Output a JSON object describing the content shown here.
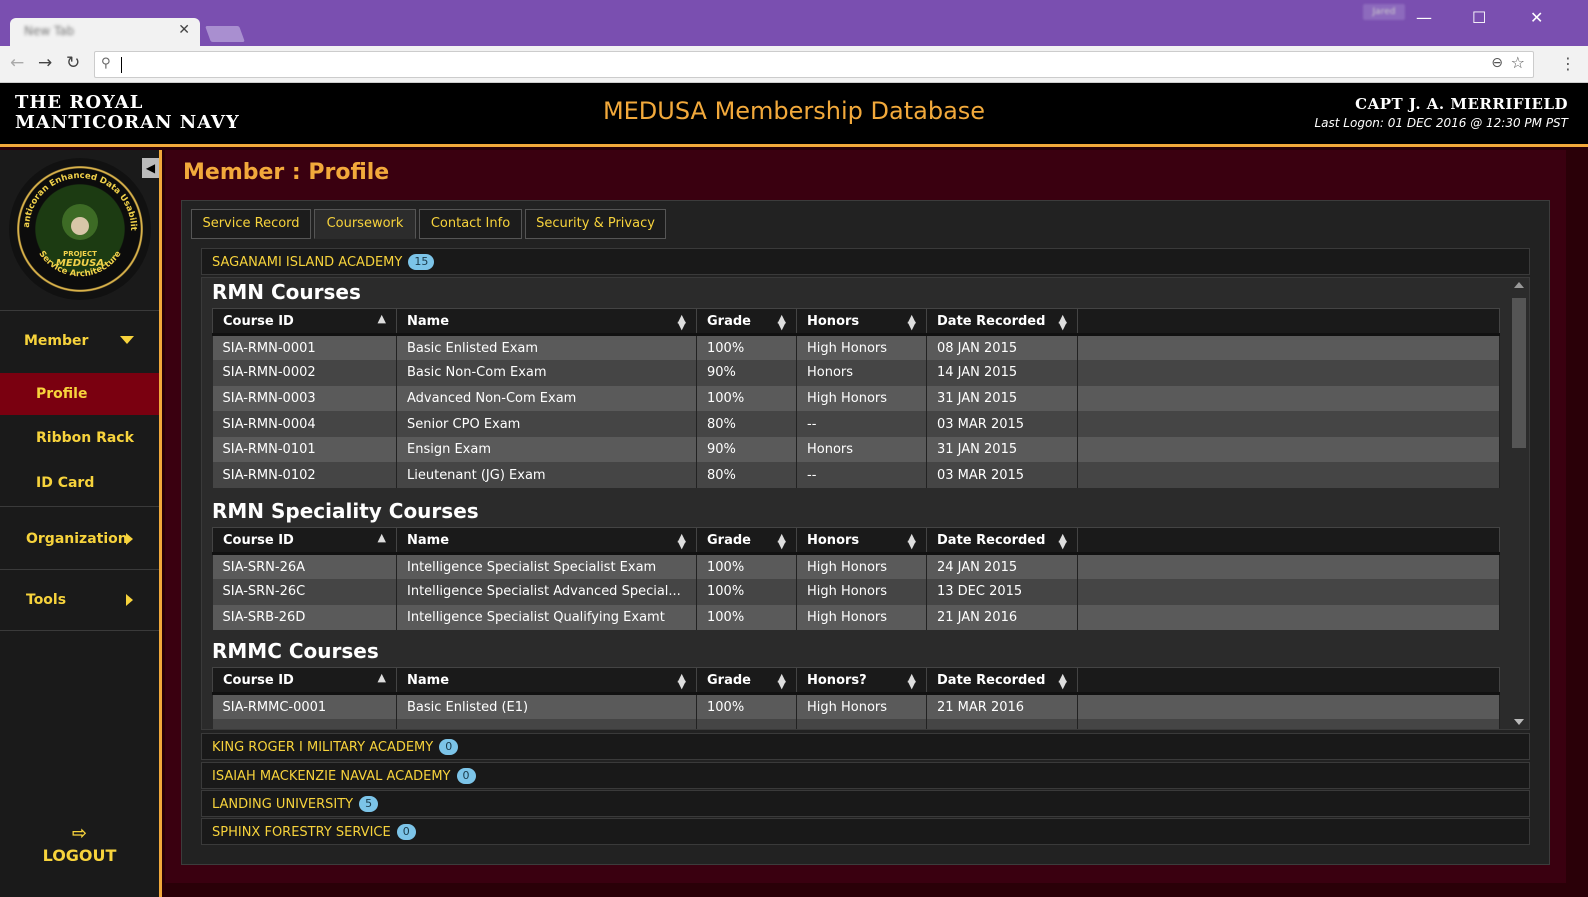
{
  "browser": {
    "tab_title": "New Tab",
    "user_chip": "Jared",
    "address_value": ""
  },
  "header": {
    "brand_line1": "THE ROYAL",
    "brand_line2": "MANTICORAN NAVY",
    "title": "MEDUSA Membership Database",
    "user_name": "CAPT J. A. MERRIFIELD",
    "last_logon": "Last Logon: 01 DEC 2016 @ 12:30 PM PST"
  },
  "logo": {
    "ring_top": "Manticoran Enhanced Data Usability",
    "ring_bottom": "Service Architecture",
    "center_line1": "PROJECT",
    "center_line2": "MEDUSA"
  },
  "sidebar": {
    "member": "Member",
    "profile": "Profile",
    "ribbon_rack": "Ribbon Rack",
    "id_card": "ID Card",
    "organization": "Organization",
    "tools": "Tools",
    "logout": "LOGOUT"
  },
  "page": {
    "title": "Member : Profile",
    "tabs": [
      "Service Record",
      "Coursework",
      "Contact Info",
      "Security & Privacy"
    ]
  },
  "academies": [
    {
      "name": "SAGANAMI ISLAND ACADEMY",
      "count": "15"
    },
    {
      "name": "KING ROGER I MILITARY ACADEMY",
      "count": "0"
    },
    {
      "name": "ISAIAH MACKENZIE NAVAL ACADEMY",
      "count": "0"
    },
    {
      "name": "LANDING UNIVERSITY",
      "count": "5"
    },
    {
      "name": "SPHINX FORESTRY SERVICE",
      "count": "0"
    }
  ],
  "sections": [
    {
      "title": "RMN Courses",
      "headers": [
        "Course ID",
        "Name",
        "Grade",
        "Honors",
        "Date Recorded"
      ],
      "rows": [
        [
          "SIA-RMN-0001",
          "Basic Enlisted Exam",
          "100%",
          "High Honors",
          "08 JAN 2015"
        ],
        [
          "SIA-RMN-0002",
          "Basic Non-Com Exam",
          "90%",
          "Honors",
          "14 JAN 2015"
        ],
        [
          "SIA-RMN-0003",
          "Advanced Non-Com Exam",
          "100%",
          "High Honors",
          "31 JAN 2015"
        ],
        [
          "SIA-RMN-0004",
          "Senior CPO Exam",
          "80%",
          "--",
          "03 MAR 2015"
        ],
        [
          "SIA-RMN-0101",
          "Ensign Exam",
          "90%",
          "Honors",
          "31 JAN 2015"
        ],
        [
          "SIA-RMN-0102",
          "Lieutenant (JG) Exam",
          "80%",
          "--",
          "03 MAR 2015"
        ]
      ]
    },
    {
      "title": "RMN Speciality Courses",
      "headers": [
        "Course ID",
        "Name",
        "Grade",
        "Honors",
        "Date Recorded"
      ],
      "rows": [
        [
          "SIA-SRN-26A",
          "Intelligence Specialist Specialist Exam",
          "100%",
          "High Honors",
          "24 JAN 2015"
        ],
        [
          "SIA-SRN-26C",
          "Intelligence Specialist Advanced Special...",
          "100%",
          "High Honors",
          "13 DEC 2015"
        ],
        [
          "SIA-SRB-26D",
          "Intelligence Specialist Qualifying Examt",
          "100%",
          "High Honors",
          "21 JAN 2016"
        ]
      ]
    },
    {
      "title": "RMMC Courses",
      "headers": [
        "Course ID",
        "Name",
        "Grade",
        "Honors?",
        "Date Recorded"
      ],
      "rows": [
        [
          "SIA-RMMC-0001",
          "Basic Enlisted (E1)",
          "100%",
          "High Honors",
          "21 MAR 2016"
        ],
        [
          "",
          "",
          "",
          "",
          ""
        ]
      ]
    }
  ],
  "colors": {
    "accent": "#f2a93b",
    "link_yellow": "#f7d33c",
    "active_red": "#7a0010",
    "chrome_purple": "#7a4fb0"
  }
}
